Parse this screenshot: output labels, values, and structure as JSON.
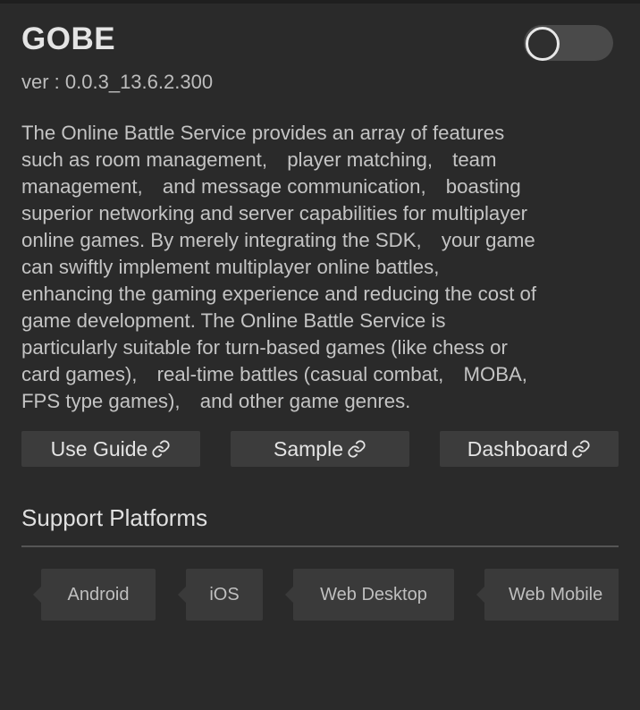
{
  "plugin": {
    "title": "GOBE",
    "version": "ver : 0.0.3_13.6.2.300",
    "enabled": false,
    "description": "The Online Battle Service provides an array of features\nsuch as room management,　player matching,　team\nmanagement,　and message communication,　boasting\nsuperior networking and server capabilities for multiplayer\nonline games. By merely integrating the SDK,　your game\ncan swiftly implement multiplayer online battles,\nenhancing the gaming experience and reducing the cost of\ngame development. The Online Battle Service is\nparticularly suitable for turn-based games (like chess or\ncard games),　real-time battles (casual combat,　MOBA,\nFPS type games),　and other game genres."
  },
  "links": [
    {
      "label": "Use Guide",
      "icon": "link-icon"
    },
    {
      "label": "Sample",
      "icon": "link-icon"
    },
    {
      "label": "Dashboard",
      "icon": "link-icon"
    }
  ],
  "platforms": {
    "title": "Support Platforms",
    "items": [
      "Android",
      "iOS",
      "Web Desktop",
      "Web Mobile"
    ]
  },
  "colors": {
    "background": "#2a2a2a",
    "button": "#3c3c3c",
    "toggle_track": "#4a4a4a"
  }
}
